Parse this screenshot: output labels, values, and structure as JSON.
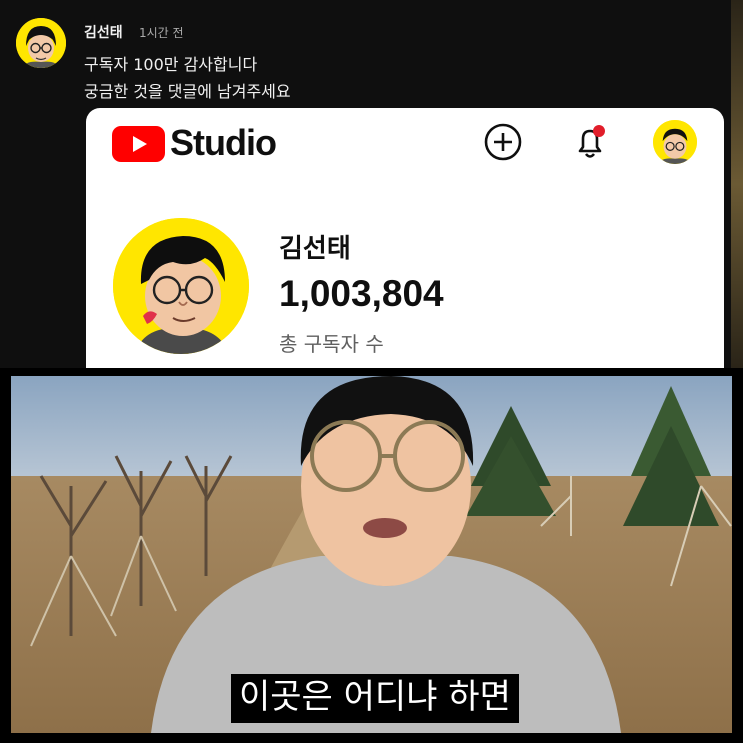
{
  "post": {
    "author": "김선태",
    "time": "1시간 전",
    "line1": "구독자 100만 감사합니다",
    "line2": "궁금한 것을 댓글에 남겨주세요"
  },
  "studio": {
    "logo_text": "Studio",
    "brand_color": "#ff0000",
    "notification_dot_color": "#e11d2a",
    "icons": [
      "youtube-logo-icon",
      "create-plus-icon",
      "notification-bell-icon"
    ],
    "channel": {
      "name": "김선태",
      "subscriber_count": "1,003,804",
      "subscriber_label": "총 구독자 수"
    }
  },
  "video": {
    "caption": "이곳은 어디냐 하면"
  }
}
